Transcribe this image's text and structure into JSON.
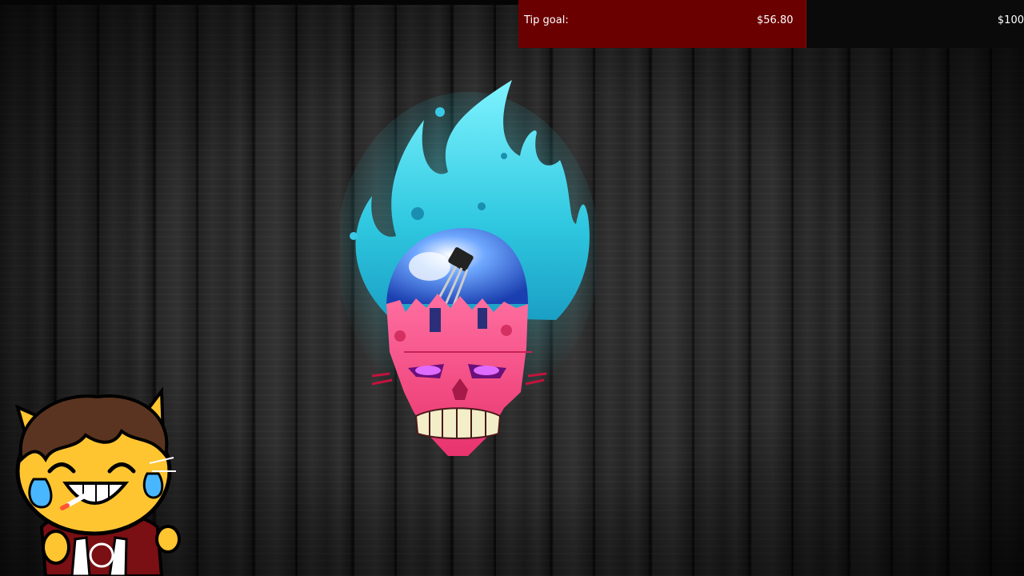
{
  "tip_goal": {
    "label": "Tip goal:",
    "current": "$56.80",
    "target": "$100",
    "progress": 0.568,
    "fill_color": "#6b0000"
  },
  "icons": {
    "center": "flaming-robot-skull-logo",
    "corner": "crying-laughing-cat-avatar"
  }
}
